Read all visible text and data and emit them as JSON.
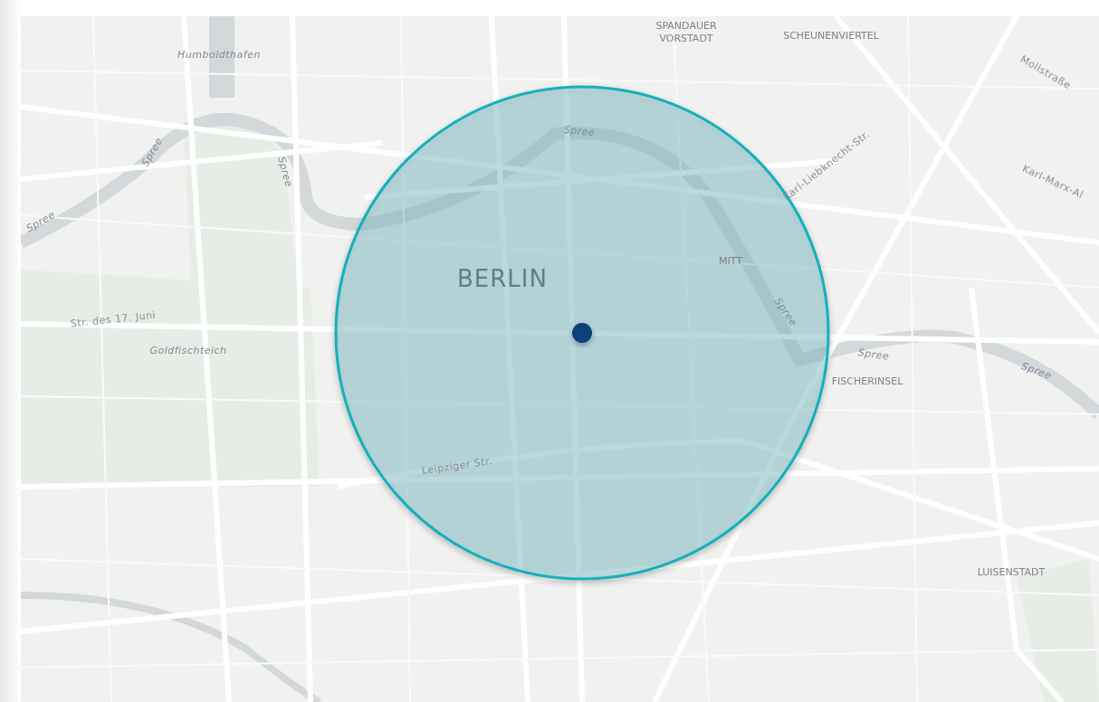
{
  "map": {
    "labels": [
      {
        "text": "Humboldthafen",
        "kind": "water"
      },
      {
        "text": "Spree",
        "kind": "water"
      },
      {
        "text": "Spree",
        "kind": "water"
      },
      {
        "text": "Spree",
        "kind": "water"
      },
      {
        "text": "SPANDAUER VORSTADT",
        "kind": "district"
      },
      {
        "text": "SCHEUNENVIERTEL",
        "kind": "district"
      },
      {
        "text": "Mollstraße",
        "kind": "street"
      },
      {
        "text": "Spree",
        "kind": "water"
      },
      {
        "text": "Karl-Liebknecht-Str.",
        "kind": "street"
      },
      {
        "text": "Karl-Marx-Al",
        "kind": "street"
      },
      {
        "text": "BERLIN",
        "kind": "city"
      },
      {
        "text": "MITT",
        "kind": "district"
      },
      {
        "text": "Spree",
        "kind": "water"
      },
      {
        "text": "Spree",
        "kind": "water"
      },
      {
        "text": "Spree",
        "kind": "water"
      },
      {
        "text": "FISCHERINSEL",
        "kind": "district"
      },
      {
        "text": "Str. des 17. Juni",
        "kind": "street"
      },
      {
        "text": "Goldfischteich",
        "kind": "water"
      },
      {
        "text": "Leipziger Str.",
        "kind": "street"
      },
      {
        "text": "LUISENSTADT",
        "kind": "district"
      }
    ]
  }
}
